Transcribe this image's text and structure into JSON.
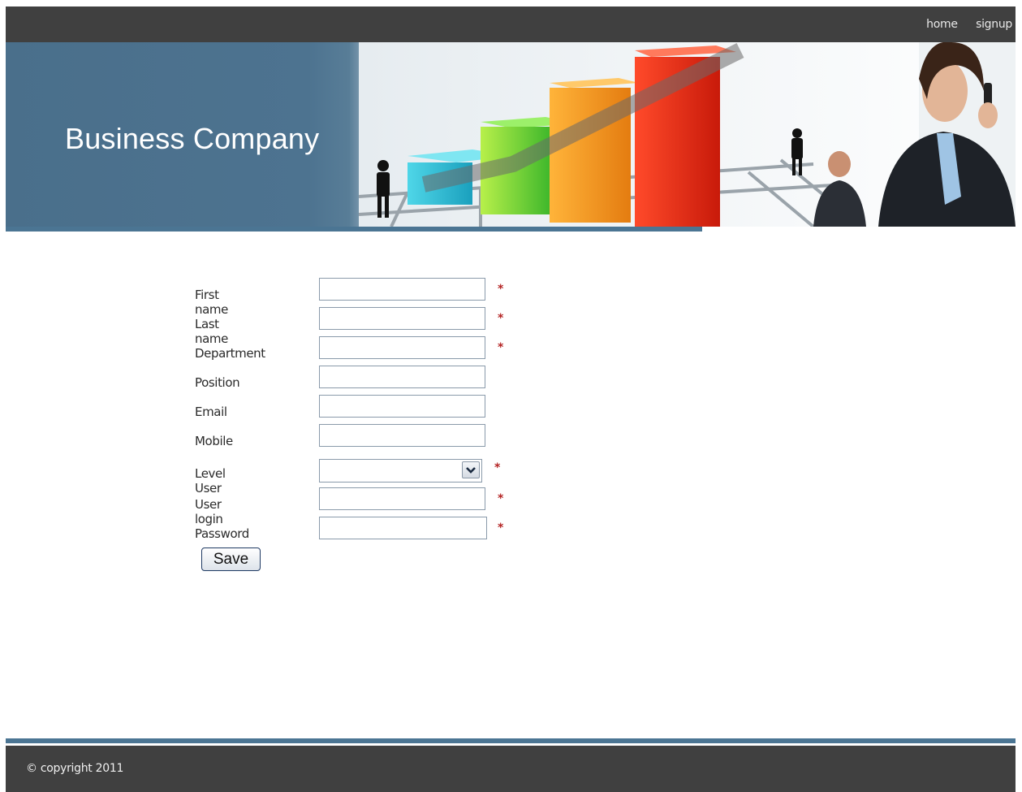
{
  "nav": {
    "home": "home",
    "signup": "signup"
  },
  "banner": {
    "title": "Business Company"
  },
  "form": {
    "first_name": "First name",
    "last_name": "Last name",
    "department": "Department",
    "position": "Position",
    "email": "Email",
    "mobile": "Mobile",
    "level_user": "Level User",
    "user_login": "User login",
    "password": "Password",
    "required_mark": "*",
    "save": "Save"
  },
  "footer": {
    "copyright": "© copyright 2011"
  },
  "colors": {
    "bar": "#404040",
    "accent": "#4b7593",
    "required": "#b42424"
  }
}
